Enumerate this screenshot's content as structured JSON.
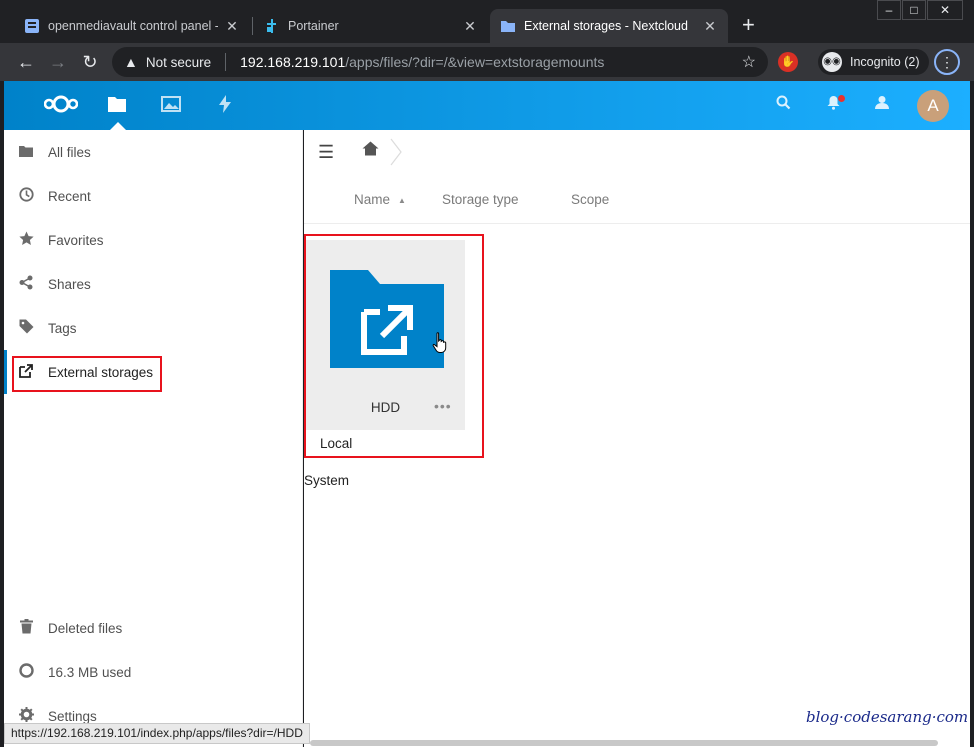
{
  "browser": {
    "tabs": [
      {
        "title": "openmediavault control panel - ",
        "active": false
      },
      {
        "title": "Portainer",
        "active": false
      },
      {
        "title": "External storages - Nextcloud",
        "active": true
      }
    ],
    "new_tab": "+",
    "window_controls": {
      "minimize": "–",
      "maximize": "□",
      "close": "✕"
    },
    "security_label": "Not secure",
    "url_host": "192.168.219.101",
    "url_path": "/apps/files/?dir=/&view=extstoragemounts",
    "profile_label": "Incognito (2)"
  },
  "header": {
    "apps": [
      "files-icon",
      "photos-icon",
      "activity-icon"
    ],
    "avatar_letter": "A"
  },
  "sidebar": {
    "items": [
      {
        "label": "All files",
        "icon": "folder-icon"
      },
      {
        "label": "Recent",
        "icon": "clock-icon"
      },
      {
        "label": "Favorites",
        "icon": "star-icon"
      },
      {
        "label": "Shares",
        "icon": "share-icon"
      },
      {
        "label": "Tags",
        "icon": "tag-icon"
      },
      {
        "label": "External storages",
        "icon": "external-link-icon"
      }
    ],
    "bottom": [
      {
        "label": "Deleted files",
        "icon": "trash-icon"
      },
      {
        "label": "16.3 MB used",
        "icon": "pie-icon"
      },
      {
        "label": "Settings",
        "icon": "gear-icon"
      }
    ]
  },
  "main": {
    "columns": [
      "Name",
      "Storage type",
      "Scope"
    ],
    "entry": {
      "name": "HDD",
      "storage_type": "Local",
      "more": "•••"
    },
    "scope_label": "System"
  },
  "status_url": "https://192.168.219.101/index.php/apps/files?dir=/HDD",
  "watermark": "blog·codesarang·com",
  "colors": {
    "brand": "#0082c9",
    "folder": "#0082c9",
    "highlight": "#e8131d"
  }
}
